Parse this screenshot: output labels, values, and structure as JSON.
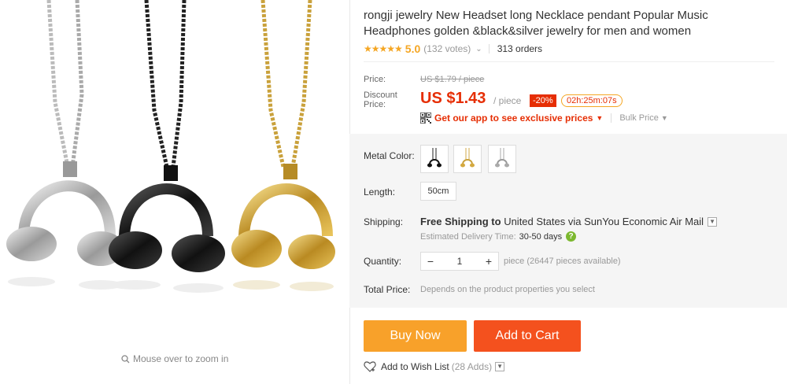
{
  "gallery": {
    "zoom_hint": "Mouse over to zoom in"
  },
  "product": {
    "title": "rongji jewelry New Headset long Necklace pendant Popular Music Headphones golden &black&silver jewelry for men and women",
    "stars": "★★★★★",
    "rating": "5.0",
    "votes": "(132 votes)",
    "orders": "313 orders"
  },
  "pricing": {
    "price_label": "Price:",
    "old_price": "US $1.79 / piece",
    "discount_label": "Discount Price:",
    "price": "US $1.43",
    "per_piece": "/ piece",
    "discount_badge": "-20%",
    "timer": "02h:25m:07s",
    "app_promo": "Get our app to see exclusive prices",
    "bulk_price": "Bulk Price"
  },
  "options": {
    "metal_color_label": "Metal Color:",
    "length_label": "Length:",
    "length_value": "50cm",
    "shipping_label": "Shipping:",
    "shipping_free": "Free Shipping to",
    "shipping_dest": "United States via SunYou Economic Air Mail",
    "eta_label": "Estimated Delivery Time:",
    "eta_days": "30-50 days",
    "quantity_label": "Quantity:",
    "quantity_minus": "−",
    "quantity_value": "1",
    "quantity_plus": "+",
    "quantity_note": "piece (26447 pieces available)",
    "total_label": "Total Price:",
    "total_note": "Depends on the product properties you select"
  },
  "actions": {
    "buy_now": "Buy Now",
    "add_to_cart": "Add to Cart",
    "wishlist": "Add to Wish List",
    "wishlist_count": "(28 Adds)"
  },
  "colors": {
    "accent_red": "#e62e04",
    "buy_now_orange": "#f8a12a",
    "add_cart_orange": "#f4511e",
    "star_gold": "#f5a623"
  }
}
